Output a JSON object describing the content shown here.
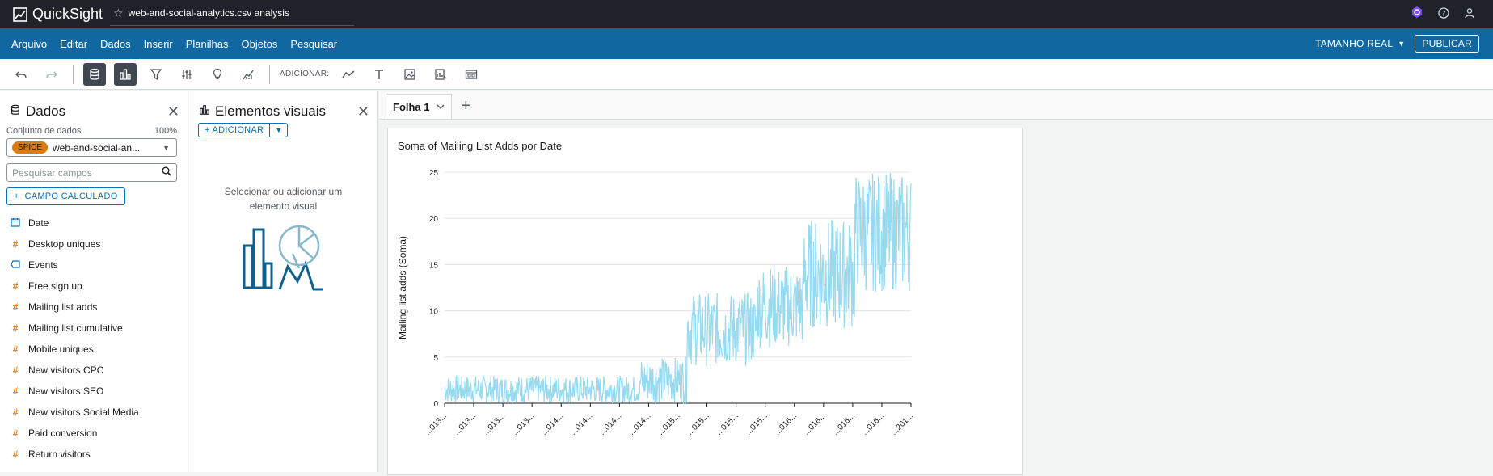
{
  "app": {
    "name": "QuickSight",
    "analysis_title": "web-and-social-analytics.csv analysis"
  },
  "menu": {
    "items": [
      "Arquivo",
      "Editar",
      "Dados",
      "Inserir",
      "Planilhas",
      "Objetos",
      "Pesquisar"
    ],
    "size_label": "TAMANHO REAL",
    "publish_label": "PUBLICAR"
  },
  "toolbar": {
    "add_label": "ADICIONAR:"
  },
  "data_panel": {
    "title": "Dados",
    "dataset_label": "Conjunto de dados",
    "dataset_percent": "100%",
    "spice_badge": "SPICE",
    "dataset_name": "web-and-social-an...",
    "search_placeholder": "Pesquisar campos",
    "calc_field_label": "CAMPO CALCULADO",
    "fields": [
      {
        "name": "Date",
        "icon": "calendar-icon"
      },
      {
        "name": "Desktop uniques",
        "icon": "hash-icon"
      },
      {
        "name": "Events",
        "icon": "tag-icon"
      },
      {
        "name": "Free sign up",
        "icon": "hash-icon"
      },
      {
        "name": "Mailing list adds",
        "icon": "hash-icon"
      },
      {
        "name": "Mailing list cumulative",
        "icon": "hash-icon"
      },
      {
        "name": "Mobile uniques",
        "icon": "hash-icon"
      },
      {
        "name": "New visitors CPC",
        "icon": "hash-icon"
      },
      {
        "name": "New visitors SEO",
        "icon": "hash-icon"
      },
      {
        "name": "New visitors Social Media",
        "icon": "hash-icon"
      },
      {
        "name": "Paid conversion",
        "icon": "hash-icon"
      },
      {
        "name": "Return visitors",
        "icon": "hash-icon"
      }
    ]
  },
  "visuals_panel": {
    "title": "Elementos visuais",
    "add_label": "ADICIONAR",
    "empty_message": "Selecionar ou adicionar um elemento visual"
  },
  "sheet": {
    "tab_label": "Folha 1"
  },
  "colors": {
    "series": "#96daf0",
    "spice": "#d97c16",
    "menubar": "#1167a0"
  },
  "chart_data": {
    "type": "line",
    "title": "Soma of Mailing List Adds por Date",
    "ylabel": "Mailing list adds (Soma)",
    "xlabel": "",
    "ylim": [
      0,
      25
    ],
    "yticks": [
      0,
      5,
      10,
      15,
      20,
      25
    ],
    "xtick_labels": [
      "...013...",
      "...013...",
      "...013...",
      "...013...",
      "...014...",
      "...014...",
      "...014...",
      "...014...",
      "...015...",
      "...015...",
      "...015...",
      "...015...",
      "...016...",
      "...016...",
      "...016...",
      "...016...",
      "...201..."
    ],
    "series": [
      {
        "segments": [
          {
            "from": 0.0,
            "to": 0.52,
            "min": 0,
            "max": 3
          },
          {
            "from": 0.42,
            "to": 0.52,
            "min": 0,
            "max": 5
          },
          {
            "from": 0.52,
            "to": 0.67,
            "min": 4,
            "max": 12
          },
          {
            "from": 0.67,
            "to": 0.77,
            "min": 6,
            "max": 15
          },
          {
            "from": 0.77,
            "to": 0.88,
            "min": 8,
            "max": 20
          },
          {
            "from": 0.88,
            "to": 1.0,
            "min": 12,
            "max": 25
          }
        ]
      }
    ],
    "grid": true
  }
}
